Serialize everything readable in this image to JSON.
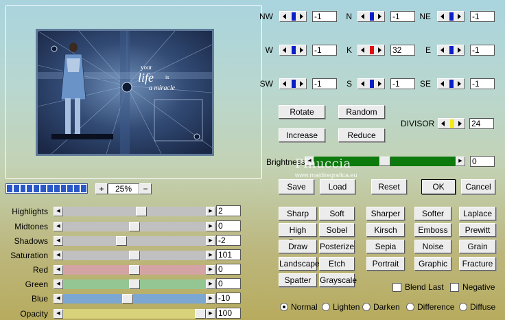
{
  "preview": {
    "art_text_line1": "your",
    "art_text_line2": "life",
    "art_text_line3": "is",
    "art_text_line4": "a miracle"
  },
  "zoom": {
    "progress_segments": 12,
    "plus_label": "+",
    "value": "25%",
    "minus_label": "−"
  },
  "sliders": [
    {
      "label": "Highlights",
      "value": "2",
      "fraction": 0.55,
      "color": "#c0c0c0"
    },
    {
      "label": "Midtones",
      "value": "0",
      "fraction": 0.5,
      "color": "#c0c0c0"
    },
    {
      "label": "Shadows",
      "value": "-2",
      "fraction": 0.4,
      "color": "#c0c0c0"
    },
    {
      "label": "Saturation",
      "value": "101",
      "fraction": 0.5,
      "color": "#c0c0c0"
    },
    {
      "label": "Red",
      "value": "0",
      "fraction": 0.5,
      "color": "#d4a3a3"
    },
    {
      "label": "Green",
      "value": "0",
      "fraction": 0.5,
      "color": "#93c693"
    },
    {
      "label": "Blue",
      "value": "-10",
      "fraction": 0.45,
      "color": "#7da7d3"
    },
    {
      "label": "Opacity",
      "value": "100",
      "fraction": 1.0,
      "color": "#d8d27a"
    }
  ],
  "compass": [
    {
      "label": "NW",
      "value": "-1",
      "mark_color": "#0a1ec8"
    },
    {
      "label": "N",
      "value": "-1",
      "mark_color": "#0a1ec8"
    },
    {
      "label": "NE",
      "value": "-1",
      "mark_color": "#0a1ec8"
    },
    {
      "label": "W",
      "value": "-1",
      "mark_color": "#0a1ec8"
    },
    {
      "label": "K",
      "value": "32",
      "mark_color": "#e01010"
    },
    {
      "label": "E",
      "value": "-1",
      "mark_color": "#0a1ec8"
    },
    {
      "label": "SW",
      "value": "-1",
      "mark_color": "#0a1ec8"
    },
    {
      "label": "S",
      "value": "-1",
      "mark_color": "#0a1ec8"
    },
    {
      "label": "SE",
      "value": "-1",
      "mark_color": "#0a1ec8"
    }
  ],
  "actions": {
    "rotate": "Rotate",
    "random": "Random",
    "increase": "Increase",
    "reduce": "Reduce",
    "divisor_label": "DIVISOR",
    "divisor_value": "24",
    "divisor_mark_color": "#f2ea14"
  },
  "brightness": {
    "label": "Brightness",
    "value": "0",
    "fraction": 0.5,
    "watermark": "Pinuccia",
    "watermark_url": "www.maidiregrafica.eu"
  },
  "dialog": {
    "save": "Save",
    "load": "Load",
    "reset": "Reset",
    "ok": "OK",
    "cancel": "Cancel"
  },
  "presets": [
    [
      "Sharp",
      "Soft",
      "Sharper",
      "Softer",
      "Laplace"
    ],
    [
      "High Pass",
      "Sobel",
      "Kirsch",
      "Emboss",
      "Prewitt"
    ],
    [
      "Draw",
      "Posterize",
      "Sepia",
      "Noise",
      "Grain"
    ],
    [
      "Landscape",
      "Etch",
      "Portrait",
      "Graphic",
      "Fracture"
    ],
    [
      "Spatter",
      "Grayscale"
    ]
  ],
  "checkboxes": {
    "blend_last": "Blend Last",
    "negative": "Negative"
  },
  "modes": {
    "options": [
      "Normal",
      "Lighten",
      "Darken",
      "Difference",
      "Diffuse"
    ],
    "selected": "Normal"
  }
}
